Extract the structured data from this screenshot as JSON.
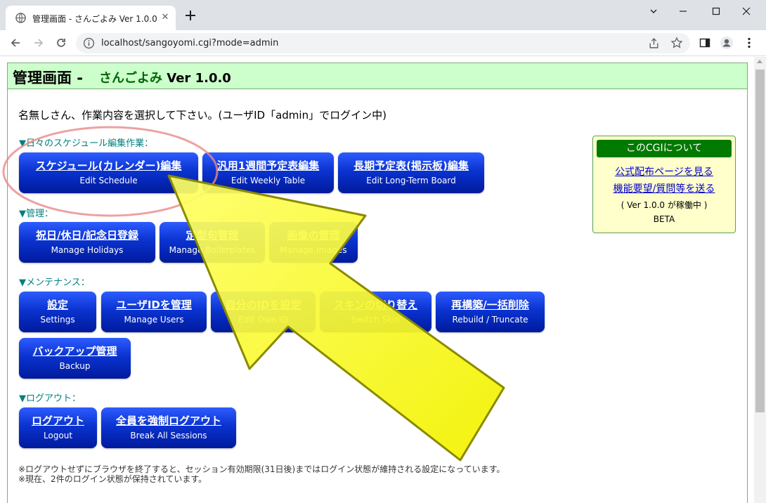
{
  "browser": {
    "tab_title": "管理画面 - さんごよみ Ver 1.0.0",
    "tab_close": "✕",
    "url": "localhost/sangoyomi.cgi?mode=admin"
  },
  "page": {
    "header_main": "管理画面 -",
    "header_app": "さんごよみ",
    "header_ver": "Ver 1.0.0",
    "greeting": "名無しさん、作業内容を選択して下さい。(ユーザID「admin」でログイン中)"
  },
  "sections": {
    "schedule": "▼日々のスケジュール編集作業：",
    "manage": "▼管理：",
    "maintenance": "▼メンテナンス：",
    "logout": "▼ログアウト："
  },
  "buttons": {
    "edit_schedule": {
      "ja": "スケジュール(カレンダー)編集",
      "en": "Edit Schedule"
    },
    "edit_weekly": {
      "ja": "汎用1週間予定表編集",
      "en": "Edit Weekly Table"
    },
    "edit_longterm": {
      "ja": "長期予定表(掲示板)編集",
      "en": "Edit Long-Term Board"
    },
    "holidays": {
      "ja": "祝日/休日/記念日登録",
      "en": "Manage Holidays"
    },
    "boilerplates": {
      "ja": "定型句管理",
      "en": "Manage Boilerplates"
    },
    "images": {
      "ja": "画像の管理",
      "en": "Manage Images"
    },
    "settings": {
      "ja": "設定",
      "en": "Settings"
    },
    "users": {
      "ja": "ユーザIDを管理",
      "en": "Manage Users"
    },
    "own_id": {
      "ja": "自分のIDを設定",
      "en": "Edit Own ID"
    },
    "skin": {
      "ja": "スキンの切り替え",
      "en": "Switch Skin"
    },
    "rebuild": {
      "ja": "再構築/一括削除",
      "en": "Rebuild / Truncate"
    },
    "backup": {
      "ja": "バックアップ管理",
      "en": "Backup"
    },
    "logout": {
      "ja": "ログアウト",
      "en": "Logout"
    },
    "break_sessions": {
      "ja": "全員を強制ログアウト",
      "en": "Break All Sessions"
    }
  },
  "about": {
    "title": "このCGIについて",
    "link1": "公式配布ページを見る",
    "link2": "機能要望/質問等を送る",
    "version": "( Ver 1.0.0 が稼働中 )",
    "beta": "BETA"
  },
  "notes": {
    "line1": "※ログアウトせずにブラウザを終了すると、セッション有効期限(31日後)まではログイン状態が維持される設定になっています。",
    "line2": "※現在、2件のログイン状態が保持されています。"
  },
  "annotation": {
    "highlight_color": "#e88a8a",
    "arrow_color": "#ffff00"
  }
}
